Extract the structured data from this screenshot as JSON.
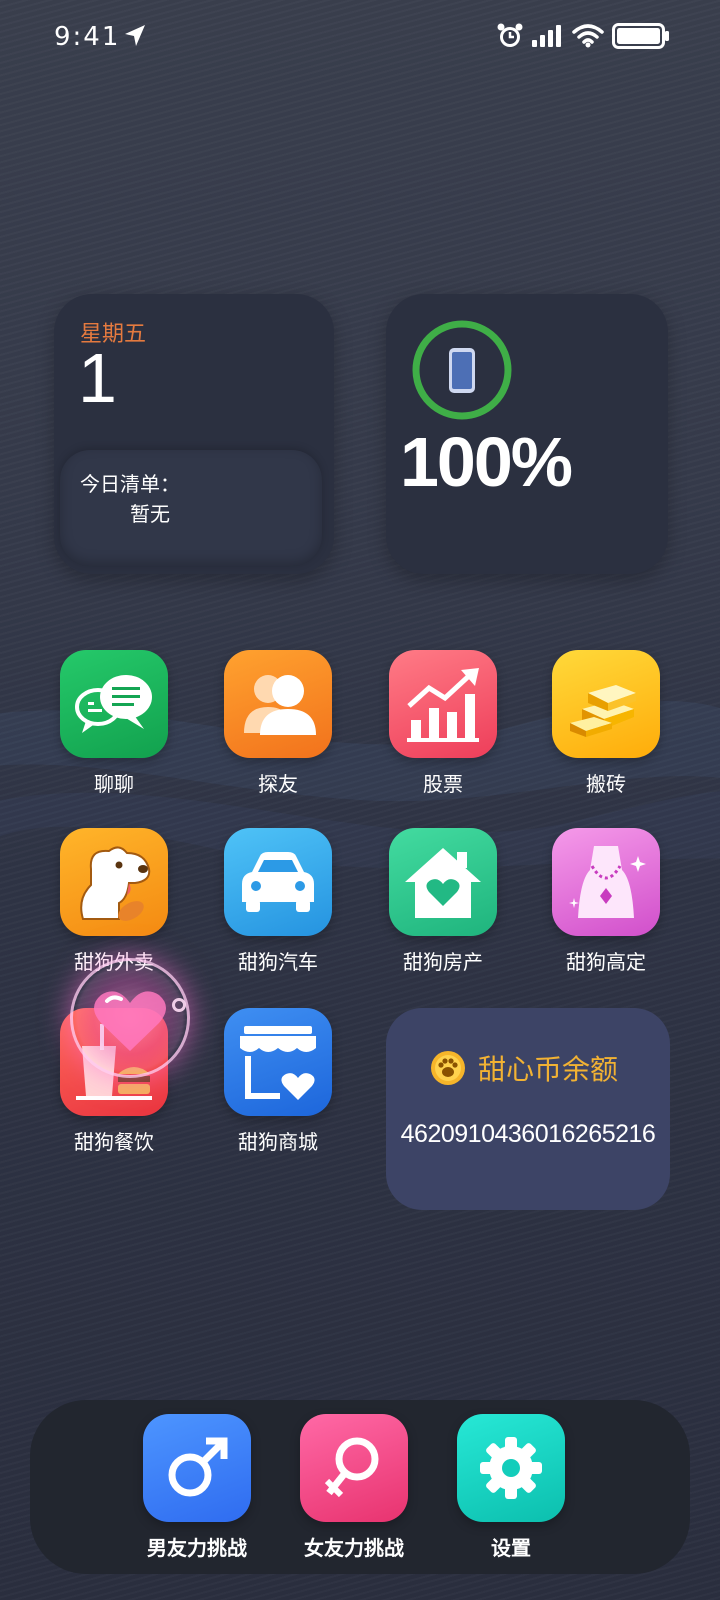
{
  "status_bar": {
    "time": "9:41",
    "icons": [
      "location-arrow-icon",
      "alarm-icon",
      "cellular-signal-icon",
      "wifi-icon",
      "battery-icon"
    ]
  },
  "date_widget": {
    "weekday": "星期五",
    "day": "1",
    "todo_title": "今日清单：",
    "todo_value": "暂无"
  },
  "battery_widget": {
    "percent_text": "100%",
    "level": 1.0,
    "ring_color": "#3fae47"
  },
  "apps": [
    {
      "label": "聊聊",
      "icon": "chat-bubbles-icon",
      "color": "#19b45c"
    },
    {
      "label": "探友",
      "icon": "friends-icon",
      "color": "#f9892a"
    },
    {
      "label": "股票",
      "icon": "stock-chart-icon",
      "color": "#f2546b"
    },
    {
      "label": "搬砖",
      "icon": "gold-bars-icon",
      "color": "#fdb714"
    },
    {
      "label": "甜狗外卖",
      "icon": "dog-icon",
      "color": "#f9a41c"
    },
    {
      "label": "甜狗汽车",
      "icon": "car-icon",
      "color": "#37a7ec"
    },
    {
      "label": "甜狗房产",
      "icon": "house-heart-icon",
      "color": "#2ec892"
    },
    {
      "label": "甜狗高定",
      "icon": "necklace-icon",
      "color": "#e264d6"
    },
    {
      "label": "甜狗餐饮",
      "icon": "food-icon",
      "color": "#f0483f"
    },
    {
      "label": "甜狗商城",
      "icon": "store-heart-icon",
      "color": "#2f7ee8"
    }
  ],
  "coin_card": {
    "title": "甜心币余额",
    "value": "46209104360162652​16",
    "icon": "paw-coin-icon"
  },
  "dock": [
    {
      "label": "男友力挑战",
      "icon": "male-symbol-icon",
      "color": "#3a86ff"
    },
    {
      "label": "女友力挑战",
      "icon": "female-symbol-icon",
      "color": "#f3478a"
    },
    {
      "label": "设置",
      "icon": "gear-icon",
      "color": "#13d6c4"
    }
  ],
  "colors": {
    "background": "#343949",
    "weekday_accent": "#e57a3f",
    "coin_accent": "#f2b233"
  }
}
